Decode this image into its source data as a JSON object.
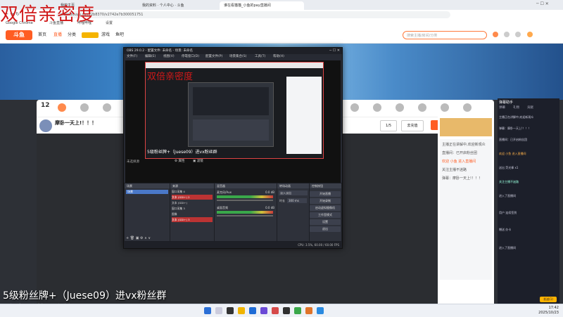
{
  "overlay": {
    "watermark": "双倍亲密度",
    "caption1": "5级粉丝牌+（Juese09）进vx粉丝群",
    "caption2": "5级粉丝牌上房管"
  },
  "browser": {
    "tabs": [
      "我的主页",
      "我的资料 · 个人中心 · 斗鱼",
      "谁在看猫猫_小鱼的pay直播间"
    ],
    "url": "www.douyu.com/2b8370/v2742e7b300051751",
    "bookmarks": [
      "Google Chrome",
      "斗鱼直播",
      "哔哩哔哩",
      "设置"
    ]
  },
  "site": {
    "logo": "斗鱼",
    "nav": [
      "首页",
      "直播",
      "分类",
      "游戏",
      "鱼吧"
    ],
    "search_placeholder": "搜索主播/房间/分类",
    "room_number": "12",
    "streamer_title": "摩卧一天上!！！！",
    "follow": "关注",
    "fans": "1/5",
    "recharge": "去充值"
  },
  "obs": {
    "title": "OBS 29.0.2 - 配置文件: 未命名 - 场景: 未命名",
    "menu": [
      "文件(F)",
      "编辑(E)",
      "视图(V)",
      "停靠窗口(D)",
      "配置文件(P)",
      "场景集合(S)",
      "工具(T)",
      "帮助(H)"
    ],
    "inner_watermark": "双倍亲密度",
    "inner_caption": "5级粉丝牌+（Juese09）进vx粉丝群",
    "source_label": "未选择源",
    "props_btn": "属性",
    "filter_btn": "滤镜",
    "docks": {
      "scenes": "场景",
      "sources": "来源",
      "mixer": "混音器",
      "transitions": "转场动画",
      "controls": "控制按钮"
    },
    "scene_items": [
      "场景"
    ],
    "source_items": [
      "窗口采集 4",
      "文本 (GDI+) 2",
      "文本 (GDI+)",
      "窗口采集 3",
      "图像",
      "文本 (GDI+) 3"
    ],
    "mixer_items": [
      "麦克风/Aux",
      "桌面音频"
    ],
    "mixer_db": [
      "0.0 dB",
      "0.0 dB"
    ],
    "transition_type": "淡入淡出",
    "duration_label": "时长",
    "duration": "300 ms",
    "controls": [
      "开始直播",
      "开始录制",
      "启动虚拟摄像机",
      "工作室模式",
      "设置",
      "退出"
    ],
    "status": "CPU: 3.5%,  60.00 / 60.00 FPS"
  },
  "chatpanel": {
    "header": "弹幕助手",
    "tabs": [
      "弹幕",
      "礼物",
      "贡献"
    ],
    "messages": [
      "主播正在讲解中,欢迎新观众",
      "弹幕：摩卧一天上!！！！",
      "直播间：已开启粉丝团",
      "欢迎 小鱼 进入直播间",
      "送出 荧光棒 x1",
      "关注主播不迷路",
      "进入了直播间",
      "用户 连续签到",
      "赠送 办卡",
      "进入了直播间"
    ],
    "bottom_btn": "发送(1)"
  },
  "taskbar": {
    "time": "17:42",
    "date": "2025/10/23"
  },
  "colors": {
    "accent": "#ff5d23",
    "obs_bg": "#272a33",
    "danmu_red": "#d01818"
  }
}
